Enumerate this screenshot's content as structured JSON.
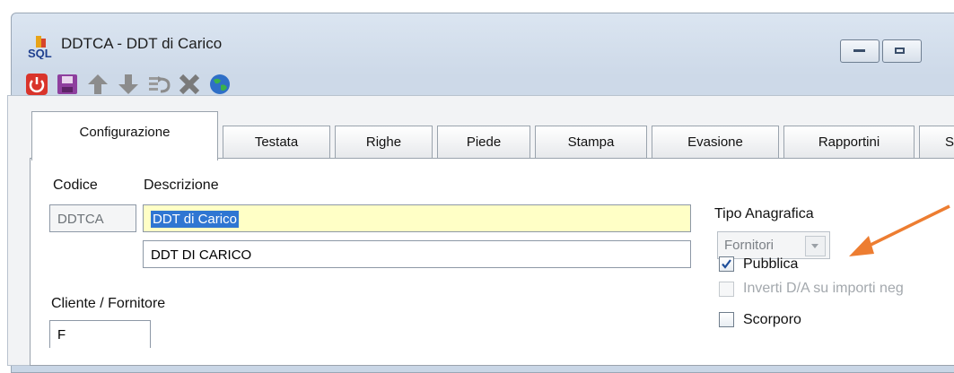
{
  "window": {
    "title": "DDTCA - DDT di Carico"
  },
  "tabs": [
    {
      "label": "Configurazione"
    },
    {
      "label": "Testata"
    },
    {
      "label": "Righe"
    },
    {
      "label": "Piede"
    },
    {
      "label": "Stampa"
    },
    {
      "label": "Evasione"
    },
    {
      "label": "Rapportini"
    },
    {
      "label": "S"
    }
  ],
  "form": {
    "codice_label": "Codice",
    "descrizione_label": "Descrizione",
    "codice_value": "DDTCA",
    "descrizione_value": "DDT di Carico",
    "descrizione2_value": "DDT DI CARICO",
    "cliente_fornitore_label": "Cliente / Fornitore",
    "cliente_fornitore_value": "F",
    "tipo_anagrafica_label": "Tipo Anagrafica",
    "tipo_anagrafica_value": "Fornitori",
    "pubblica_label": "Pubblica",
    "pubblica_checked": true,
    "inverti_label": "Inverti D/A su importi neg",
    "scorporo_label": "Scorporo"
  },
  "colors": {
    "arrow": "#ed7d31",
    "accent": "#2f76d2",
    "highlight": "#ffffc6"
  }
}
